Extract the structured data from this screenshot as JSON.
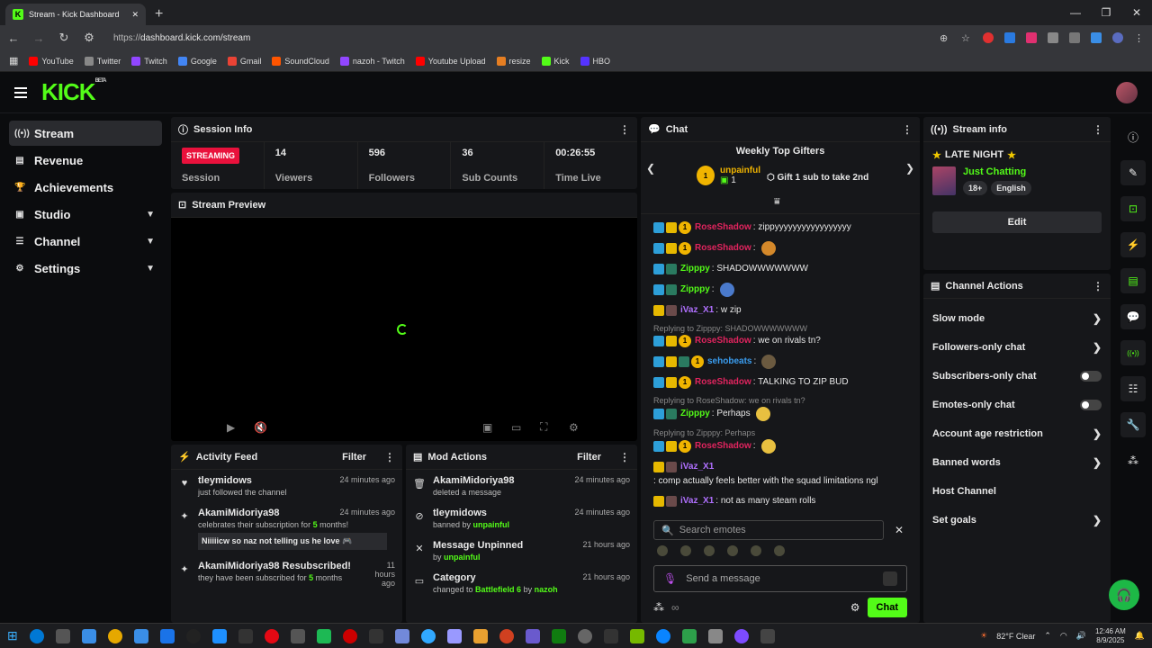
{
  "browser": {
    "tab_title": "Stream - Kick Dashboard",
    "url_prefix": "https://",
    "url_main": "dashboard.kick.com/stream",
    "bookmarks": [
      {
        "label": "YouTube",
        "color": "#ff0000"
      },
      {
        "label": "Twitter",
        "color": "#888888"
      },
      {
        "label": "Twitch",
        "color": "#9146ff"
      },
      {
        "label": "Google",
        "color": "#4285f4"
      },
      {
        "label": "Gmail",
        "color": "#ea4335"
      },
      {
        "label": "SoundCloud",
        "color": "#ff5500"
      },
      {
        "label": "nazoh - Twitch",
        "color": "#9146ff"
      },
      {
        "label": "Youtube Upload",
        "color": "#ff0000"
      },
      {
        "label": "resize",
        "color": "#e67e22"
      },
      {
        "label": "Kick",
        "color": "#53fc18"
      },
      {
        "label": "HBO",
        "color": "#5533ff"
      }
    ]
  },
  "kick": {
    "logo": "KICK",
    "beta": "BETA"
  },
  "sidebar": {
    "items": [
      {
        "label": "Stream",
        "icon": "broadcast-icon",
        "glyph": "((•))",
        "active": true
      },
      {
        "label": "Revenue",
        "icon": "chart-icon",
        "glyph": "▤"
      },
      {
        "label": "Achievements",
        "icon": "trophy-icon",
        "glyph": "🏆"
      },
      {
        "label": "Studio",
        "icon": "studio-icon",
        "glyph": "▣",
        "chevron": true
      },
      {
        "label": "Channel",
        "icon": "channel-icon",
        "glyph": "☰",
        "chevron": true
      },
      {
        "label": "Settings",
        "icon": "gear-icon",
        "glyph": "⚙",
        "chevron": true
      }
    ]
  },
  "session": {
    "title": "Session Info",
    "badge": "STREAMING",
    "badge_label": "Session",
    "stats": [
      {
        "value": "14",
        "label": "Viewers"
      },
      {
        "value": "596",
        "label": "Followers"
      },
      {
        "value": "36",
        "label": "Sub Counts"
      },
      {
        "value": "00:26:55",
        "label": "Time Live"
      }
    ]
  },
  "preview": {
    "title": "Stream Preview"
  },
  "activity": {
    "title": "Activity Feed",
    "filter": "Filter",
    "items": [
      {
        "icon": "heart-icon",
        "glyph": "♥",
        "user": "tleymidows",
        "text": "just followed the channel",
        "time": "24 minutes ago"
      },
      {
        "icon": "star-off-icon",
        "glyph": "✦",
        "user": "AkamiMidoriya98",
        "text_a": "celebrates their subscription for ",
        "months": "5",
        "text_b": " months!",
        "time": "24 minutes ago",
        "quote": "Niiiiicw so naz not telling us he love 🎮"
      },
      {
        "icon": "sparkle-icon",
        "glyph": "✦",
        "user": "AkamiMidoriya98 Resubscribed!",
        "text_a": "they have been subscribed for ",
        "months": "5",
        "text_b": " months",
        "time": "11 hours ago"
      }
    ]
  },
  "mod": {
    "title": "Mod Actions",
    "filter": "Filter",
    "items": [
      {
        "icon": "trash-icon",
        "glyph": "🗑",
        "user": "AkamiMidoriya98",
        "text": "deleted a message",
        "time": "24 minutes ago"
      },
      {
        "icon": "ban-icon",
        "glyph": "⊘",
        "user": "tleymidows",
        "text_a": "banned by ",
        "by": "unpainful",
        "time": "24 minutes ago"
      },
      {
        "icon": "unpin-icon",
        "glyph": "✕",
        "user": "Message Unpinned",
        "text_a": "by ",
        "by": "unpainful",
        "time": "21 hours ago"
      },
      {
        "icon": "category-icon",
        "glyph": "▭",
        "user": "Category",
        "text_a": "changed to ",
        "by": "Battlefield 6",
        "text_c": " by ",
        "by2": "nazoh",
        "time": "21 hours ago"
      }
    ]
  },
  "chat": {
    "title": "Chat",
    "gifters_title": "Weekly Top Gifters",
    "top_gifter": "unpainful",
    "top_gifter_rank": "1",
    "top_gifter_count": "1",
    "gift_cta": "Gift 1 sub to take 2nd",
    "messages": [
      {
        "user": "RoseShadow",
        "color": "#e0245e",
        "text": ": zippyyyyyyyyyyyyyyyyy",
        "badges": [
          "mod",
          "vip",
          "sub"
        ]
      },
      {
        "user": "RoseShadow",
        "color": "#e0245e",
        "text": ":",
        "badges": [
          "mod",
          "vip",
          "sub"
        ],
        "emote": "#d4882a"
      },
      {
        "user": "Zipppy",
        "color": "#53fc18",
        "text": ": SHADOWWWWWWW",
        "badges": [
          "mod",
          "sub2"
        ]
      },
      {
        "user": "Zipppy",
        "color": "#53fc18",
        "text": ":",
        "badges": [
          "mod",
          "sub2"
        ],
        "emote": "#4a7acc"
      },
      {
        "user": "iVaz_X1",
        "color": "#b070ff",
        "text": ": w zip",
        "badges": [
          "vip",
          "av"
        ]
      },
      {
        "reply": "Replying to Zipppy: SHADOWWWWWWW",
        "user": "RoseShadow",
        "color": "#e0245e",
        "text": ": we on rivals tn?",
        "badges": [
          "mod",
          "vip",
          "sub"
        ]
      },
      {
        "user": "sehobeats",
        "color": "#3a9df0",
        "text": ":",
        "badges": [
          "mod",
          "vip",
          "sub2",
          "sub"
        ],
        "emote": "#6b5a40"
      },
      {
        "user": "RoseShadow",
        "color": "#e0245e",
        "text": ": TALKING TO ZIP BUD",
        "badges": [
          "mod",
          "vip",
          "sub"
        ]
      },
      {
        "reply": "Replying to RoseShadow: we on rivals tn?",
        "user": "Zipppy",
        "color": "#53fc18",
        "text": ": Perhaps",
        "badges": [
          "mod",
          "sub2"
        ],
        "emote": "#e8c040"
      },
      {
        "reply": "Replying to Zipppy: Perhaps",
        "user": "RoseShadow",
        "color": "#e0245e",
        "text": ":",
        "badges": [
          "mod",
          "vip",
          "sub"
        ],
        "emote": "#e8c040"
      },
      {
        "user": "iVaz_X1",
        "color": "#b070ff",
        "text": ": comp actually feels better with the squad limitations ngl",
        "badges": [
          "vip",
          "av"
        ]
      },
      {
        "user": "iVaz_X1",
        "color": "#b070ff",
        "text": ": not as many steam rolls",
        "badges": [
          "vip",
          "av"
        ]
      }
    ],
    "search_placeholder": "Search emotes",
    "send_placeholder": "Send a message",
    "send_button": "Chat"
  },
  "stream_info": {
    "title": "Stream info",
    "stream_title": "LATE NIGHT",
    "category": "Just Chatting",
    "tags": [
      "18+",
      "English"
    ],
    "edit": "Edit"
  },
  "channel_actions": {
    "title": "Channel Actions",
    "items": [
      {
        "label": "Slow mode",
        "type": "arrow"
      },
      {
        "label": "Followers-only chat",
        "type": "arrow"
      },
      {
        "label": "Subscribers-only chat",
        "type": "toggle"
      },
      {
        "label": "Emotes-only chat",
        "type": "toggle"
      },
      {
        "label": "Account age restriction",
        "type": "arrow"
      },
      {
        "label": "Banned words",
        "type": "arrow"
      },
      {
        "label": "Host Channel",
        "type": "none"
      },
      {
        "label": "Set goals",
        "type": "arrow"
      }
    ]
  },
  "rail": [
    {
      "icon": "info-icon",
      "glyph": "ⓘ",
      "style": "plain"
    },
    {
      "icon": "pencil-icon",
      "glyph": "✎",
      "style": ""
    },
    {
      "icon": "screen-icon",
      "glyph": "⊡",
      "style": "g"
    },
    {
      "icon": "bolt-icon",
      "glyph": "⚡",
      "style": "g"
    },
    {
      "icon": "note-icon",
      "glyph": "▤",
      "style": "g"
    },
    {
      "icon": "chat-bubble-icon",
      "glyph": "💬",
      "style": "g"
    },
    {
      "icon": "signal-icon",
      "glyph": "((•))",
      "style": "g"
    },
    {
      "icon": "layout-icon",
      "glyph": "☷",
      "style": ""
    },
    {
      "icon": "wrench-icon",
      "glyph": "🔧",
      "style": ""
    },
    {
      "icon": "network-icon",
      "glyph": "⁂",
      "style": "plain"
    }
  ],
  "taskbar": {
    "weather": "82°F  Clear",
    "time": "12:46 AM",
    "date": "8/9/2025",
    "apps": [
      "#0078d4",
      "#555",
      "#3a8ee6",
      "#e6a800",
      "#3a8ee6",
      "#1a73e8",
      "#222",
      "#1e90ff",
      "#333",
      "#e50914",
      "#555",
      "#1db954",
      "#c00",
      "#333",
      "#7289da",
      "#31a8ff",
      "#9999ff",
      "#e8a030",
      "#d04020",
      "#6a5acd",
      "#107c10",
      "#666",
      "#333",
      "#76b900",
      "#0a84ff",
      "#2d9f4a",
      "#888",
      "#7d4bff",
      "#444"
    ]
  }
}
